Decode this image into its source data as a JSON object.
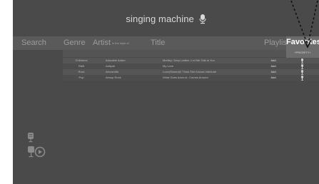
{
  "app": {
    "title": "singing machine"
  },
  "columns": {
    "search": "Search",
    "genre": "Genre",
    "artist": "Artist",
    "artist_sub": "in the style of",
    "title": "Title",
    "playlist": "Playlist",
    "favorites": "Favorites",
    "priority": "+PRIORITY+"
  },
  "songs": [
    {
      "genre": "Childrens",
      "artist": "Adorable Arden",
      "title": "Medley: Sexy Ladies / Let Me Talk to You",
      "action": "Add"
    },
    {
      "genre": "R&B",
      "artist": "Aaliyah",
      "title": "My Love",
      "action": "Add"
    },
    {
      "genre": "Rock",
      "artist": "Aerosmith",
      "title": "Love(Stoned)/I Think She Knows Interlude",
      "action": "Add"
    },
    {
      "genre": "Pop",
      "artist": "Aesop Rock",
      "title": "What Goes Around...Comes Around",
      "action": "Add"
    }
  ],
  "icons": {
    "header": "microphone-icon",
    "favorite": "microphone-icon",
    "side_top": "mic-karaoke-icon",
    "side_bottom": "mic-play-icon"
  },
  "colors": {
    "background": "#4a4a4a",
    "header_bar": "#5a5a5a",
    "favorites_header": "#6c6c6c",
    "text": "#bdbdbd"
  }
}
